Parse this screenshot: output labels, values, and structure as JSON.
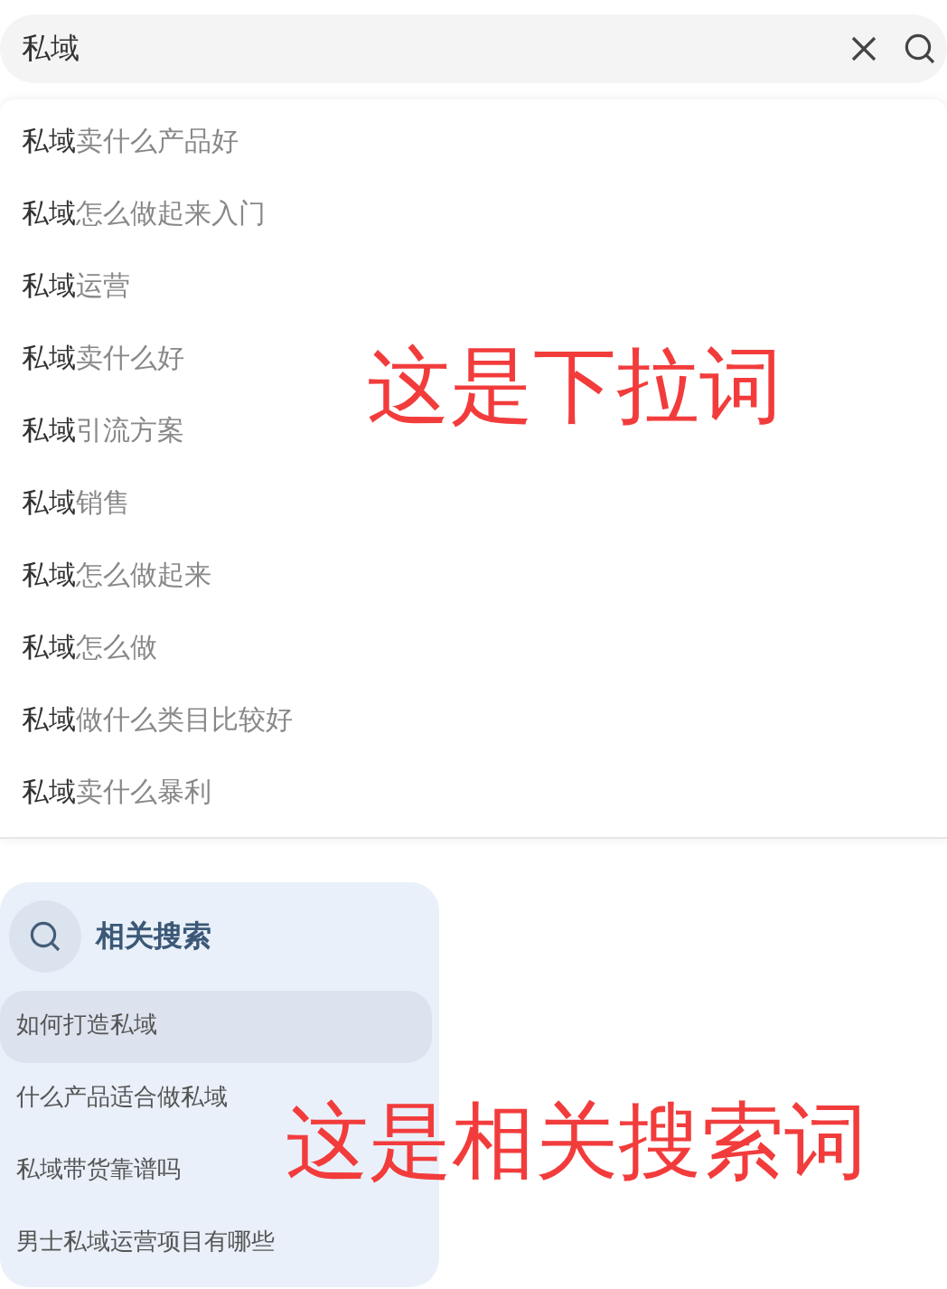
{
  "search": {
    "value": "私域"
  },
  "suggestions": [
    {
      "match": "私域",
      "rest": "卖什么产品好"
    },
    {
      "match": "私域",
      "rest": "怎么做起来入门"
    },
    {
      "match": "私域",
      "rest": "运营"
    },
    {
      "match": "私域",
      "rest": "卖什么好"
    },
    {
      "match": "私域",
      "rest": "引流方案"
    },
    {
      "match": "私域",
      "rest": "销售"
    },
    {
      "match": "私域",
      "rest": "怎么做起来"
    },
    {
      "match": "私域",
      "rest": "怎么做"
    },
    {
      "match": "私域",
      "rest": "做什么类目比较好"
    },
    {
      "match": "私域",
      "rest": "卖什么暴利"
    }
  ],
  "related": {
    "title": "相关搜索",
    "items": [
      {
        "label": "如何打造私域",
        "selected": true
      },
      {
        "label": "什么产品适合做私域",
        "selected": false
      },
      {
        "label": "私域带货靠谱吗",
        "selected": false
      },
      {
        "label": "男士私域运营项目有哪些",
        "selected": false
      }
    ]
  },
  "suggestions_annotation": "这是下拉词",
  "related_annotation": "这是相关搜索词"
}
